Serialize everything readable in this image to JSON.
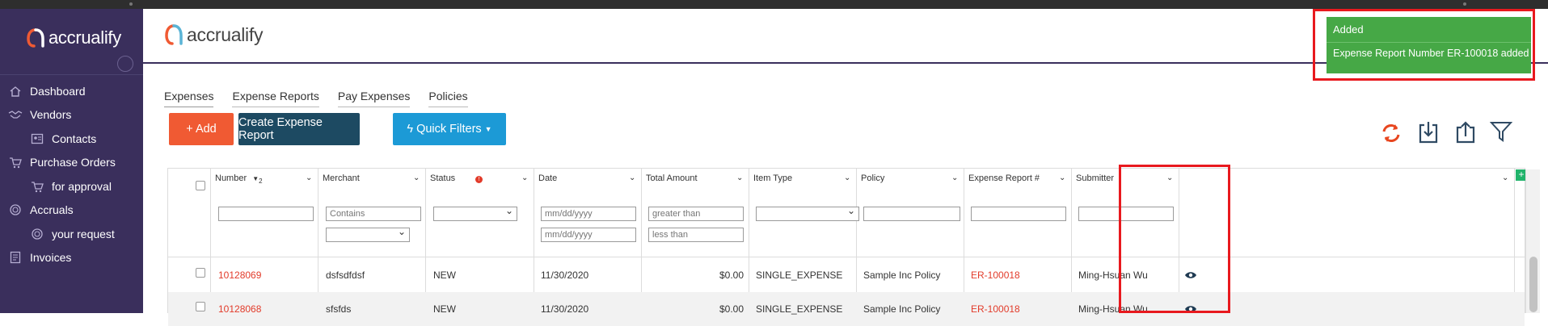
{
  "brand": {
    "name": "accrualify"
  },
  "sidebar": {
    "items": [
      {
        "label": "Dashboard",
        "icon": "home-icon"
      },
      {
        "label": "Vendors",
        "icon": "handshake-icon"
      },
      {
        "label": "Contacts",
        "icon": "contact-card-icon"
      },
      {
        "label": "Purchase Orders",
        "icon": "cart-icon"
      },
      {
        "label": "for approval",
        "icon": "cart-check-icon"
      },
      {
        "label": "Accruals",
        "icon": "coins-icon"
      },
      {
        "label": "your request",
        "icon": "coin-icon"
      },
      {
        "label": "Invoices",
        "icon": "invoice-icon"
      }
    ]
  },
  "tabs": [
    {
      "label": "Expenses",
      "active": true
    },
    {
      "label": "Expense Reports",
      "active": false
    },
    {
      "label": "Pay Expenses",
      "active": false
    },
    {
      "label": "Policies",
      "active": false
    }
  ],
  "actions": {
    "add": "+ Add",
    "create_report": "Create Expense Report",
    "quick_filters": "Quick Filters"
  },
  "toolbar_icons": [
    "refresh-icon",
    "download-icon",
    "upload-icon",
    "filter-icon"
  ],
  "table": {
    "columns": [
      {
        "key": "number",
        "label": "Number",
        "sort": "2"
      },
      {
        "key": "merchant",
        "label": "Merchant"
      },
      {
        "key": "status",
        "label": "Status"
      },
      {
        "key": "date",
        "label": "Date"
      },
      {
        "key": "total",
        "label": "Total Amount"
      },
      {
        "key": "item_type",
        "label": "Item Type"
      },
      {
        "key": "policy",
        "label": "Policy"
      },
      {
        "key": "report",
        "label": "Expense Report #"
      },
      {
        "key": "submitter",
        "label": "Submitter"
      }
    ],
    "filters": {
      "merchant_placeholder": "Contains",
      "date_placeholder": "mm/dd/yyyy",
      "amount_greater": "greater than",
      "amount_less": "less than"
    },
    "rows": [
      {
        "number": "10128069",
        "merchant": "dsfsdfdsf",
        "status": "NEW",
        "date": "11/30/2020",
        "total": "$0.00",
        "item_type": "SINGLE_EXPENSE",
        "policy": "Sample Inc Policy",
        "report": "ER-100018",
        "submitter": "Ming-Hsuan Wu"
      },
      {
        "number": "10128068",
        "merchant": "sfsfds",
        "status": "NEW",
        "date": "11/30/2020",
        "total": "$0.00",
        "item_type": "SINGLE_EXPENSE",
        "policy": "Sample Inc Policy",
        "report": "ER-100018",
        "submitter": "Ming-Hsuan Wu"
      }
    ]
  },
  "toast": {
    "title": "Added",
    "message": "Expense Report Number ER-100018 added"
  },
  "colors": {
    "sidebar": "#3a2f5c",
    "add": "#f05a33",
    "create": "#1d4a62",
    "quick": "#1c9ad6",
    "toast": "#46a846",
    "link": "#e23b2a",
    "highlight": "#e8191e"
  }
}
